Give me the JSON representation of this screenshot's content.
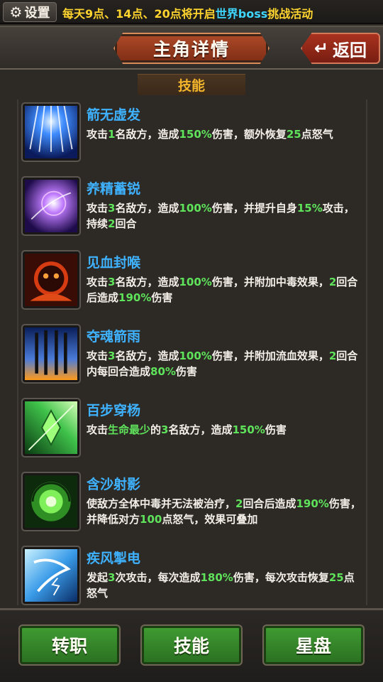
{
  "topbar": {
    "settings_label": "设置",
    "marquee": [
      {
        "text": "每天",
        "color": "yellow"
      },
      {
        "text": "9点",
        "color": "yellow"
      },
      {
        "text": "、",
        "color": "yellow"
      },
      {
        "text": "14点",
        "color": "yellow"
      },
      {
        "text": "、",
        "color": "yellow"
      },
      {
        "text": "20点",
        "color": "yellow"
      },
      {
        "text": "将开启",
        "color": "yellow"
      },
      {
        "text": "世界boss",
        "color": "cyan"
      },
      {
        "text": "挑战活动",
        "color": "yellow"
      }
    ]
  },
  "header": {
    "title": "主角详情",
    "back_label": "返回"
  },
  "section_tab": "技能",
  "skills": [
    {
      "name": "箭无虚发",
      "icon": "arrow-rain-blue-icon",
      "desc": [
        [
          "攻击"
        ],
        [
          "1",
          "hl"
        ],
        [
          "名敌方，造成"
        ],
        [
          "150%",
          "hl"
        ],
        [
          "伤害，额外恢复"
        ],
        [
          "25",
          "hl"
        ],
        [
          "点怒气"
        ]
      ]
    },
    {
      "name": "养精蓄锐",
      "icon": "energy-burst-icon",
      "desc": [
        [
          "攻击"
        ],
        [
          "3",
          "hl"
        ],
        [
          "名敌方，造成"
        ],
        [
          "100%",
          "hl"
        ],
        [
          "伤害，并提升自身"
        ],
        [
          "15%",
          "hl"
        ],
        [
          "攻击，持续"
        ],
        [
          "2",
          "hl"
        ],
        [
          "回合"
        ]
      ]
    },
    {
      "name": "见血封喉",
      "icon": "poison-demon-icon",
      "desc": [
        [
          "攻击"
        ],
        [
          "3",
          "hl"
        ],
        [
          "名敌方，造成"
        ],
        [
          "100%",
          "hl"
        ],
        [
          "伤害，并附加中毒效果，"
        ],
        [
          "2",
          "hl"
        ],
        [
          "回合后造成"
        ],
        [
          "190%",
          "hl"
        ],
        [
          "伤害"
        ]
      ]
    },
    {
      "name": "夺魂箭雨",
      "icon": "fire-arrows-icon",
      "desc": [
        [
          "攻击"
        ],
        [
          "3",
          "hl"
        ],
        [
          "名敌方，造成"
        ],
        [
          "100%",
          "hl"
        ],
        [
          "伤害，并附加流血效果，"
        ],
        [
          "2",
          "hl"
        ],
        [
          "回合内每回合造成"
        ],
        [
          "80%",
          "hl"
        ],
        [
          "伤害"
        ]
      ]
    },
    {
      "name": "百步穿杨",
      "icon": "green-arrow-icon",
      "desc": [
        [
          "攻击"
        ],
        [
          "生命最少",
          "hl"
        ],
        [
          "的"
        ],
        [
          "3",
          "hl"
        ],
        [
          "名敌方，造成"
        ],
        [
          "150%",
          "hl"
        ],
        [
          "伤害"
        ]
      ]
    },
    {
      "name": "含沙射影",
      "icon": "green-vortex-icon",
      "desc": [
        [
          "使敌方全体中毒并无法被治疗，"
        ],
        [
          "2",
          "hl"
        ],
        [
          "回合后造成"
        ],
        [
          "190%",
          "hl"
        ],
        [
          "伤害，并降低对方"
        ],
        [
          "100",
          "hl"
        ],
        [
          "点怒气，效果可叠加"
        ]
      ]
    },
    {
      "name": "疾风掣电",
      "icon": "wind-lightning-icon",
      "desc": [
        [
          "发起"
        ],
        [
          "3",
          "hl"
        ],
        [
          "次攻击，每次造成"
        ],
        [
          "180%",
          "hl"
        ],
        [
          "伤害，每次攻击恢复"
        ],
        [
          "25",
          "hl"
        ],
        [
          "点怒气"
        ]
      ]
    }
  ],
  "bottom_buttons": [
    {
      "label": "转职"
    },
    {
      "label": "技能"
    },
    {
      "label": "星盘"
    }
  ],
  "colors": {
    "skill_name": "#3fb2ff",
    "highlight": "#5fe35b",
    "marquee_yellow": "#ffd42e",
    "marquee_cyan": "#3ed6ff",
    "tab_gold": "#f4b52b"
  }
}
